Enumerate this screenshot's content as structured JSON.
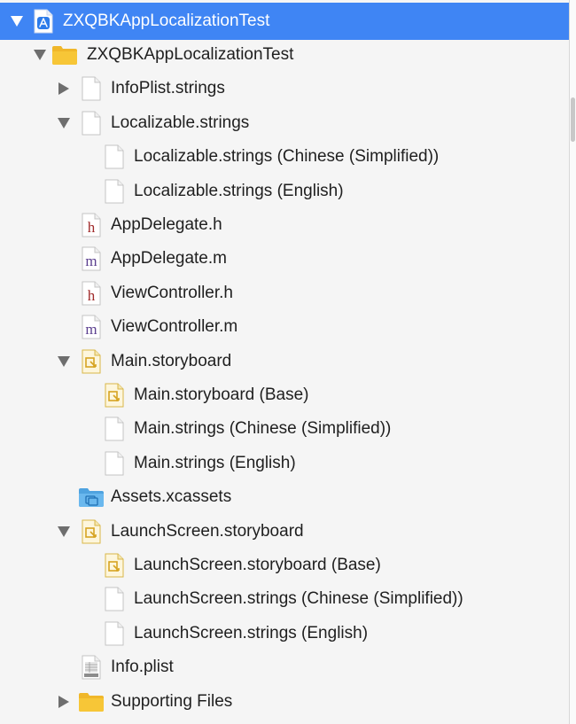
{
  "navigator": {
    "project": {
      "label": "ZXQBKAppLocalizationTest",
      "icon": "xcodeproj-icon",
      "expanded": true
    },
    "items": [
      {
        "label": "ZXQBKAppLocalizationTest",
        "icon": "folder-icon",
        "level": 1,
        "disclosure": "expanded"
      },
      {
        "label": "InfoPlist.strings",
        "icon": "strings-file-icon",
        "level": 2,
        "disclosure": "collapsed"
      },
      {
        "label": "Localizable.strings",
        "icon": "strings-file-icon",
        "level": 2,
        "disclosure": "expanded"
      },
      {
        "label": "Localizable.strings (Chinese (Simplified))",
        "icon": "strings-file-icon",
        "level": 3,
        "disclosure": "none"
      },
      {
        "label": "Localizable.strings (English)",
        "icon": "strings-file-icon",
        "level": 3,
        "disclosure": "none"
      },
      {
        "label": "AppDelegate.h",
        "icon": "header-file-icon",
        "level": 2,
        "disclosure": "none"
      },
      {
        "label": "AppDelegate.m",
        "icon": "implementation-file-icon",
        "level": 2,
        "disclosure": "none"
      },
      {
        "label": "ViewController.h",
        "icon": "header-file-icon",
        "level": 2,
        "disclosure": "none"
      },
      {
        "label": "ViewController.m",
        "icon": "implementation-file-icon",
        "level": 2,
        "disclosure": "none"
      },
      {
        "label": "Main.storyboard",
        "icon": "storyboard-icon",
        "level": 2,
        "disclosure": "expanded"
      },
      {
        "label": "Main.storyboard (Base)",
        "icon": "storyboard-icon",
        "level": 3,
        "disclosure": "none"
      },
      {
        "label": "Main.strings (Chinese (Simplified))",
        "icon": "strings-file-icon",
        "level": 3,
        "disclosure": "none"
      },
      {
        "label": "Main.strings (English)",
        "icon": "strings-file-icon",
        "level": 3,
        "disclosure": "none"
      },
      {
        "label": "Assets.xcassets",
        "icon": "asset-catalog-icon",
        "level": 2,
        "disclosure": "none"
      },
      {
        "label": "LaunchScreen.storyboard",
        "icon": "storyboard-icon",
        "level": 2,
        "disclosure": "expanded"
      },
      {
        "label": "LaunchScreen.storyboard (Base)",
        "icon": "storyboard-icon",
        "level": 3,
        "disclosure": "none"
      },
      {
        "label": "LaunchScreen.strings (Chinese (Simplified))",
        "icon": "strings-file-icon",
        "level": 3,
        "disclosure": "none"
      },
      {
        "label": "LaunchScreen.strings (English)",
        "icon": "strings-file-icon",
        "level": 3,
        "disclosure": "none"
      },
      {
        "label": "Info.plist",
        "icon": "plist-file-icon",
        "level": 2,
        "disclosure": "none"
      },
      {
        "label": "Supporting Files",
        "icon": "folder-icon",
        "level": 2,
        "disclosure": "collapsed"
      }
    ]
  },
  "colors": {
    "selection": "#3f85f4",
    "header_letter": "#a02a2a",
    "impl_letter": "#5b3f8f",
    "folder": "#f7c637",
    "disclosure": "#6e6e6e"
  }
}
